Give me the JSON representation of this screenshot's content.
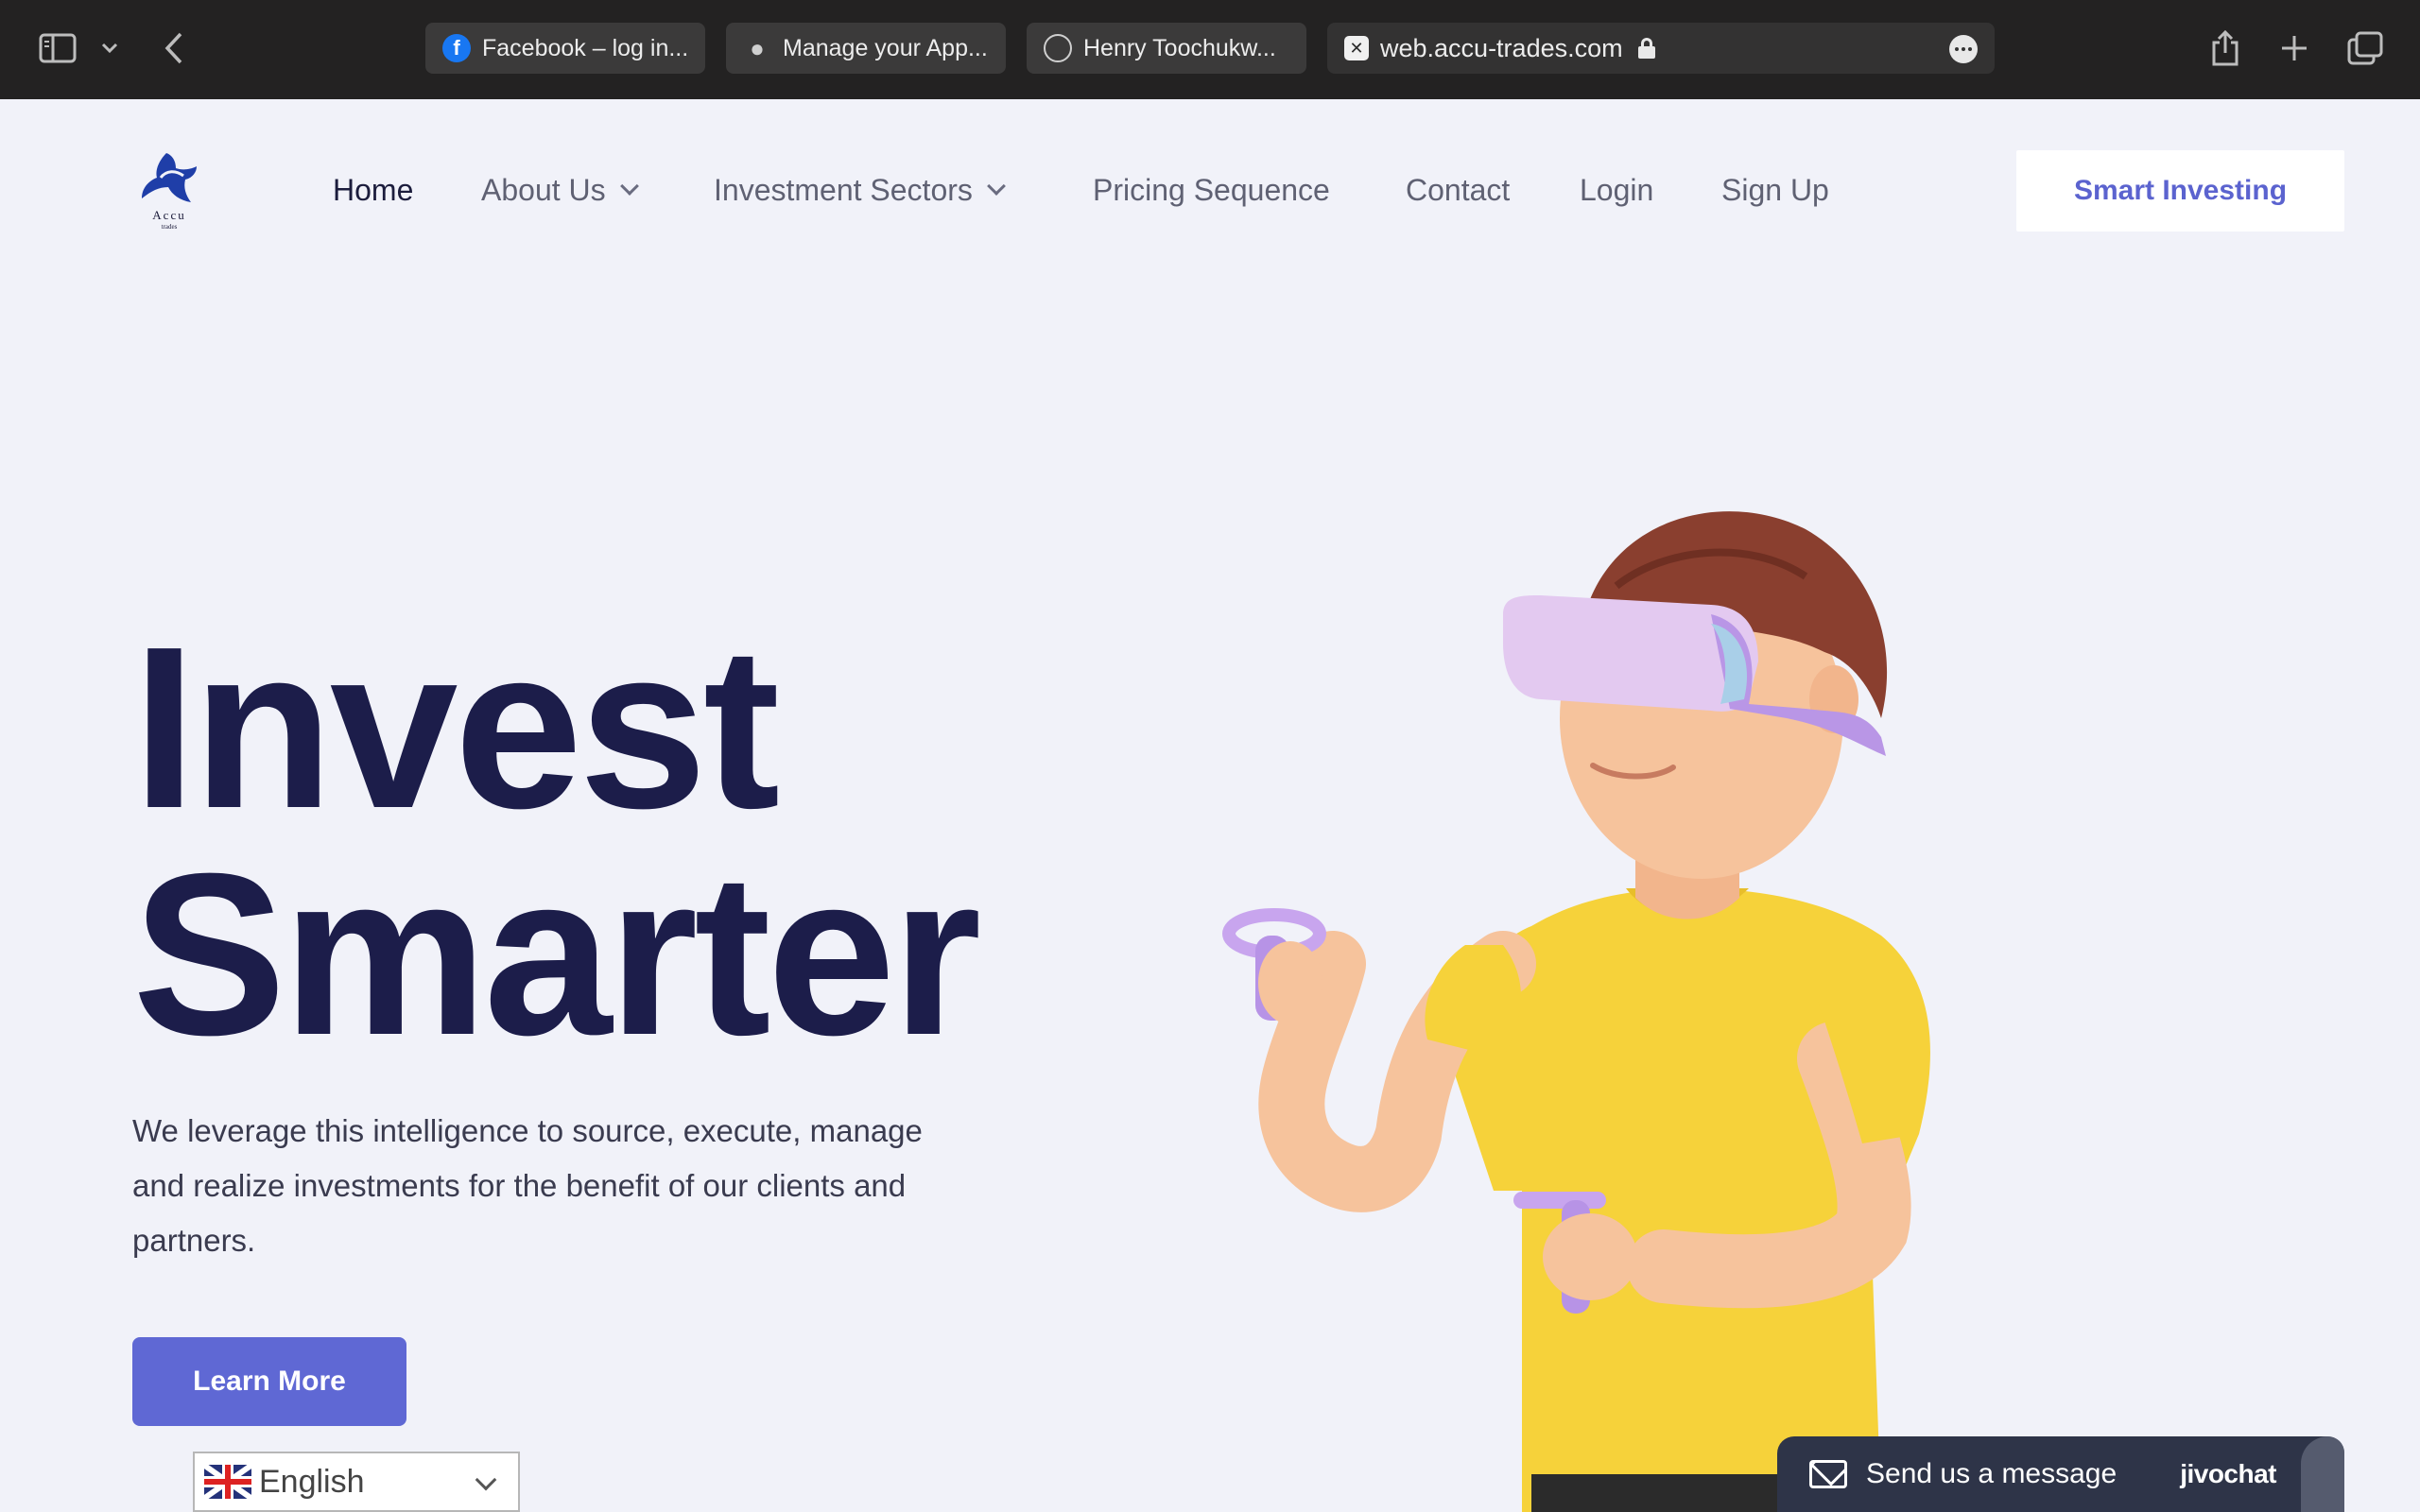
{
  "browser": {
    "tabs": [
      {
        "label": "Facebook – log in..."
      },
      {
        "label": "Manage your App..."
      },
      {
        "label": "Henry Toochukw..."
      }
    ],
    "address": "web.accu-trades.com"
  },
  "site": {
    "logo_text": "Accu",
    "logo_sub": "trades",
    "nav": {
      "home": "Home",
      "about": "About Us",
      "sectors": "Investment Sectors",
      "pricing": "Pricing Sequence",
      "contact": "Contact",
      "login": "Login",
      "signup": "Sign Up"
    },
    "cta_label": "Smart Investing"
  },
  "hero": {
    "title_line1": "Invest",
    "title_line2": "Smarter",
    "subtitle": "We leverage this intelligence to source, execute, manage and realize investments for the benefit of our clients and partners.",
    "button_label": "Learn More"
  },
  "language": {
    "selected": "English"
  },
  "chat": {
    "label": "Send us a message",
    "brand": "jivochat"
  }
}
